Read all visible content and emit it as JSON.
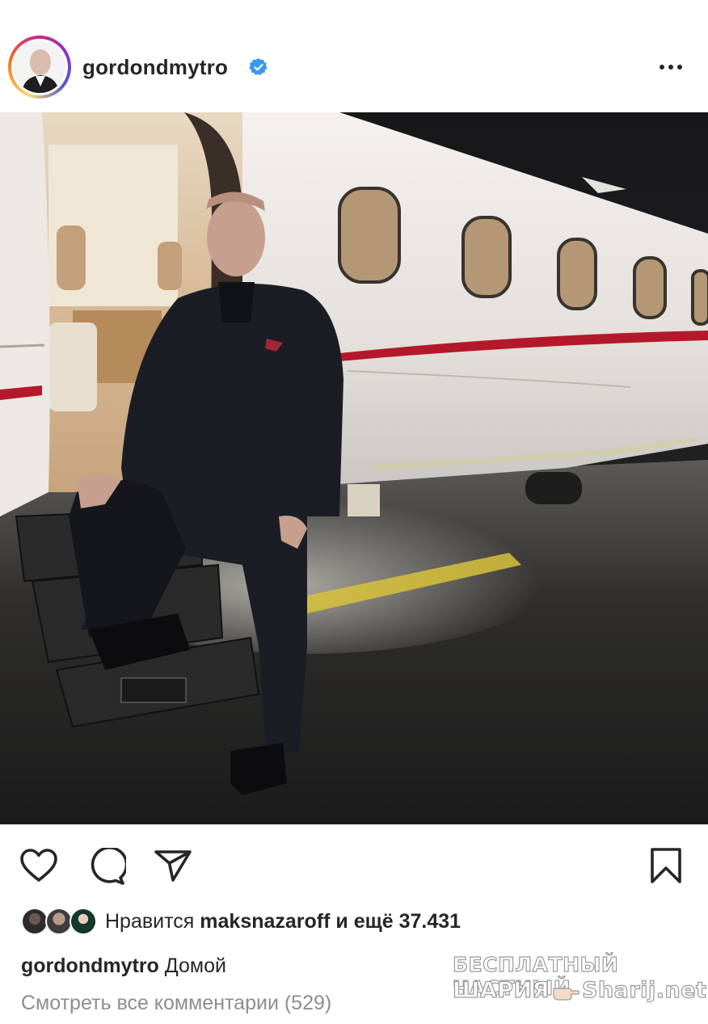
{
  "post": {
    "username": "gordondmytro",
    "verified": true,
    "more_icon": "more-horizontal-icon"
  },
  "photo": {
    "subject": "man standing on the steps of a private jet"
  },
  "actions": {
    "like_icon": "heart-icon",
    "comment_icon": "comment-icon",
    "share_icon": "send-icon",
    "save_icon": "bookmark-icon"
  },
  "likes": {
    "prefix": "Нравится",
    "liked_by": "maksnazaroff",
    "conjunction": "и ещё",
    "count": "37.431"
  },
  "caption": {
    "username": "gordondmytro",
    "text": "Домой"
  },
  "comments_link": "Смотреть все комментарии (529)",
  "watermark": {
    "line1": "БЕСПЛАТНЫЙ ЧАСТНЫЙ",
    "line2_a": "ШАРИЯ",
    "line2_b": "Sharij.net"
  },
  "colors": {
    "verified_badge": "#3897f0",
    "text_primary": "#262626",
    "text_secondary": "#8e8e8e"
  }
}
